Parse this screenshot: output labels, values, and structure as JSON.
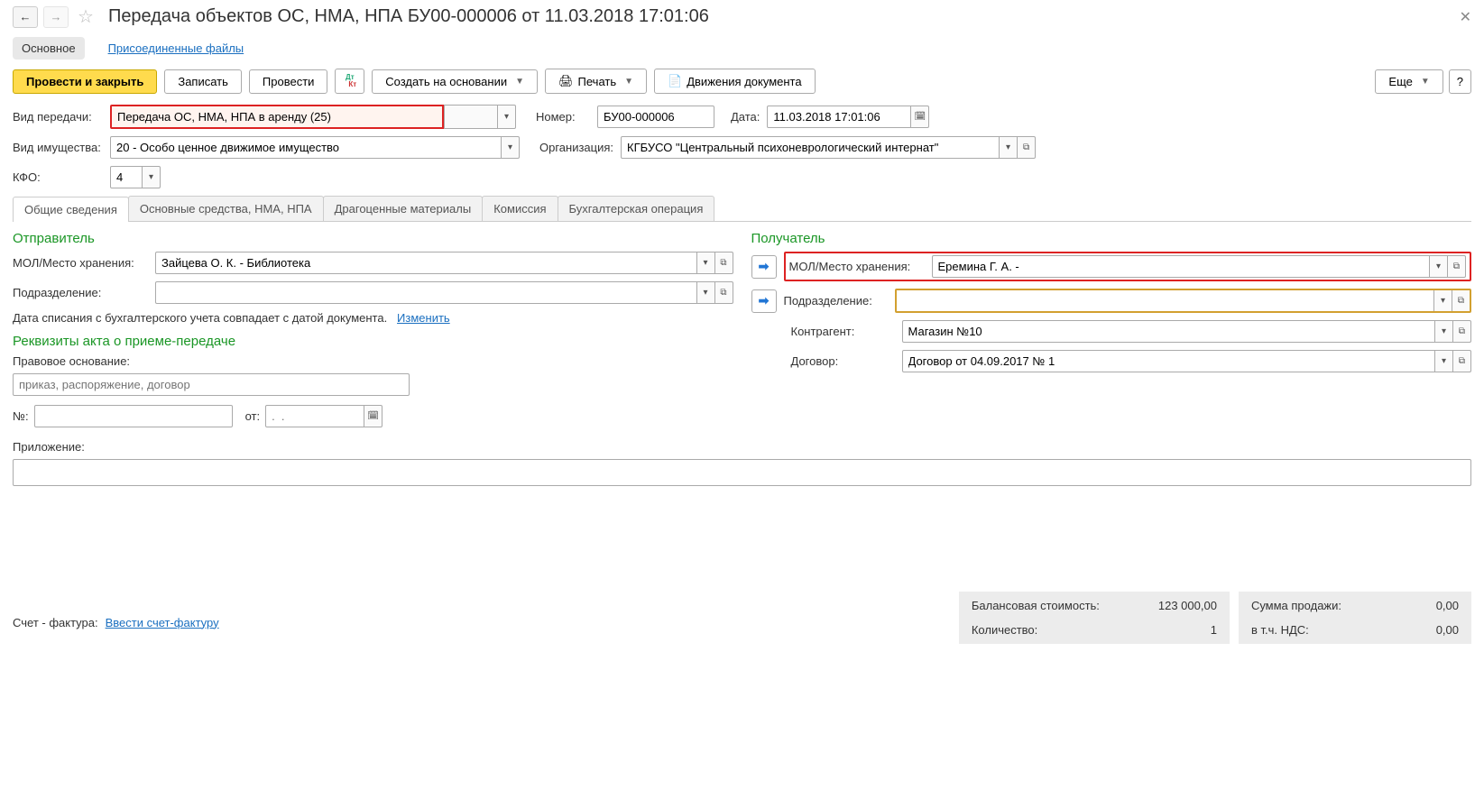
{
  "header": {
    "title": "Передача объектов ОС, НМА, НПА БУ00-000006 от 11.03.2018 17:01:06"
  },
  "mainTabs": {
    "active": "Основное",
    "link": "Присоединенные файлы"
  },
  "toolbar": {
    "postClose": "Провести и закрыть",
    "save": "Записать",
    "post": "Провести",
    "createBased": "Создать на основании",
    "print": "Печать",
    "movements": "Движения документа",
    "more": "Еще"
  },
  "fields": {
    "transferTypeLabel": "Вид передачи:",
    "transferType": "Передача ОС, НМА, НПА в аренду (25)",
    "numberLabel": "Номер:",
    "number": "БУ00-000006",
    "dateLabel": "Дата:",
    "date": "11.03.2018 17:01:06",
    "propTypeLabel": "Вид имущества:",
    "propType": "20 - Особо ценное движимое имущество",
    "orgLabel": "Организация:",
    "org": "КГБУСО \"Центральный психоневрологический интернат\"",
    "kfoLabel": "КФО:",
    "kfo": "4"
  },
  "contentTabs": [
    "Общие сведения",
    "Основные средства, НМА, НПА",
    "Драгоценные материалы",
    "Комиссия",
    "Бухгалтерская операция"
  ],
  "sender": {
    "title": "Отправитель",
    "molLabel": "МОЛ/Место хранения:",
    "mol": "Зайцева О. К. - Библиотека",
    "depLabel": "Подразделение:",
    "dep": "",
    "writeOffNote": "Дата списания с бухгалтерского учета совпадает с датой документа.",
    "change": "Изменить"
  },
  "recipient": {
    "title": "Получатель",
    "molLabel": "МОЛ/Место хранения:",
    "mol": "Еремина Г. А. -",
    "depLabel": "Подразделение:",
    "dep": "",
    "counterpartyLabel": "Контрагент:",
    "counterparty": "Магазин №10",
    "contractLabel": "Договор:",
    "contract": "Договор от 04.09.2017 № 1"
  },
  "act": {
    "title": "Реквизиты акта о приеме-передаче",
    "legalBasisLabel": "Правовое основание:",
    "legalBasisPh": "приказ, распоряжение, договор",
    "noLabel": "№:",
    "fromLabel": "от:",
    "fromPh": ".  .",
    "attachLabel": "Приложение:"
  },
  "footer": {
    "invoiceLabel": "Счет - фактура:",
    "invoiceLink": "Ввести счет-фактуру",
    "balanceLabel": "Балансовая стоимость:",
    "balance": "123 000,00",
    "qtyLabel": "Количество:",
    "qty": "1",
    "saleSumLabel": "Сумма продажи:",
    "saleSum": "0,00",
    "vatLabel": "в т.ч. НДС:",
    "vat": "0,00"
  }
}
